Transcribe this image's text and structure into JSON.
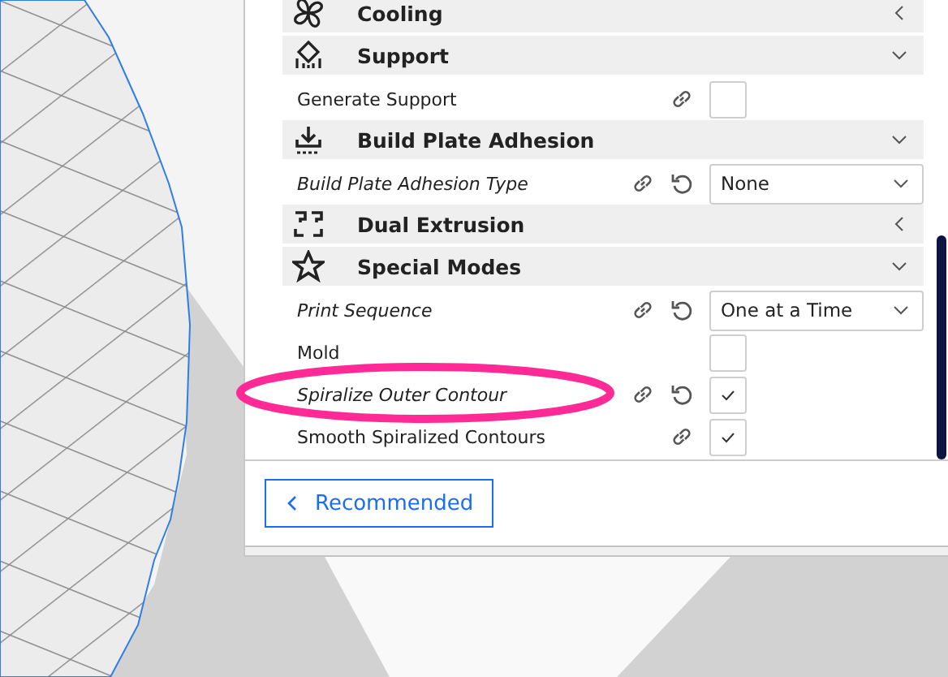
{
  "settings_panel": {
    "items": [
      {
        "kind": "header",
        "title": "Cooling",
        "expanded": false
      },
      {
        "kind": "header",
        "title": "Support",
        "expanded": true
      },
      {
        "kind": "setting",
        "label": "Generate Support",
        "modified": false,
        "linked": true,
        "resettable": false,
        "control": {
          "kind": "checkbox",
          "checked": false
        }
      },
      {
        "kind": "header",
        "title": "Build Plate Adhesion",
        "expanded": true
      },
      {
        "kind": "setting",
        "label": "Build Plate Adhesion Type",
        "modified": true,
        "linked": true,
        "resettable": true,
        "control": {
          "kind": "dropdown",
          "value": "None"
        }
      },
      {
        "kind": "header",
        "title": "Dual Extrusion",
        "expanded": false
      },
      {
        "kind": "header",
        "title": "Special Modes",
        "expanded": true
      },
      {
        "kind": "setting",
        "label": "Print Sequence",
        "modified": true,
        "linked": true,
        "resettable": true,
        "control": {
          "kind": "dropdown",
          "value": "One at a Time"
        }
      },
      {
        "kind": "setting",
        "label": "Mold",
        "modified": false,
        "linked": false,
        "resettable": false,
        "control": {
          "kind": "checkbox",
          "checked": false
        }
      },
      {
        "kind": "setting",
        "label": "Spiralize Outer Contour",
        "modified": true,
        "linked": true,
        "resettable": true,
        "control": {
          "kind": "checkbox",
          "checked": true
        }
      },
      {
        "kind": "setting",
        "label": "Smooth Spiralized Contours",
        "modified": false,
        "linked": true,
        "resettable": false,
        "control": {
          "kind": "checkbox",
          "checked": true
        }
      }
    ],
    "recommended_button": {
      "label": "Recommended"
    }
  }
}
